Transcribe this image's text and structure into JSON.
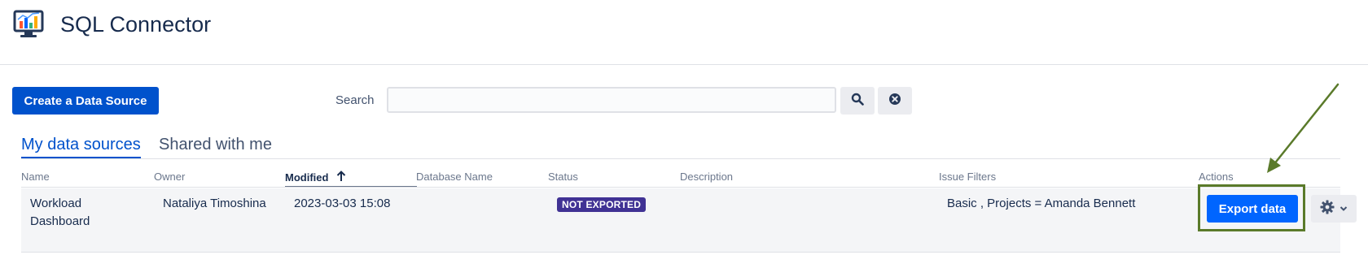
{
  "app": {
    "title": "SQL Connector",
    "logo_icon": "monitor-chart-icon"
  },
  "toolbar": {
    "create_button_label": "Create a Data Source",
    "search_label": "Search",
    "search_value": "",
    "search_placeholder": "",
    "search_icon": "magnifier-icon",
    "clear_icon": "x-circle-icon"
  },
  "tabs": [
    {
      "label": "My data sources",
      "active": true
    },
    {
      "label": "Shared with me",
      "active": false
    }
  ],
  "table": {
    "columns": [
      "Name",
      "Owner",
      "Modified",
      "Database Name",
      "Status",
      "Description",
      "Issue Filters",
      "Actions"
    ],
    "sorted_column": "Modified",
    "sort_direction": "ascending",
    "rows": [
      {
        "name_line1": "Workload",
        "name_line2": "Dashboard",
        "owner": "Nataliya Timoshina",
        "modified": "2023-03-03 15:08",
        "database_name": "",
        "status": "NOT EXPORTED",
        "description": "",
        "issue_filters": "Basic , Projects = Amanda Bennett",
        "action_label": "Export data",
        "action_menu_icon": "gear-icon"
      }
    ]
  },
  "colors": {
    "primary": "#0052cc",
    "export_button": "#0065ff",
    "status_badge": "#403294",
    "annotation": "#5a7a2a"
  }
}
